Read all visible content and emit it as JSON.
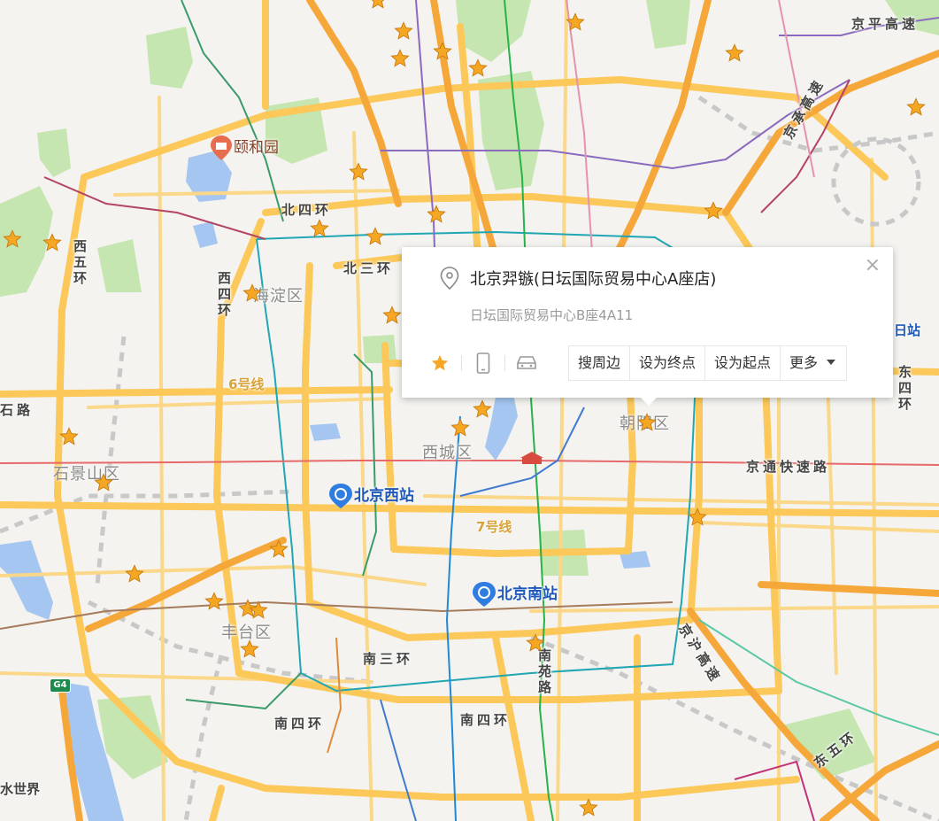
{
  "popup": {
    "title": "北京羿镞(日坛国际贸易中心A座店)",
    "address": "日坛国际贸易中心B座4A11",
    "close_label": "×",
    "actions": [
      "搜周边",
      "设为终点",
      "设为起点",
      "更多"
    ],
    "icons": [
      "star-icon",
      "phone-icon",
      "car-icon"
    ]
  },
  "districts": [
    "海淀区",
    "西城区",
    "朝阳区",
    "石景山区",
    "丰台区"
  ],
  "roads": {
    "bei_si_huan": "北四环",
    "bei_san_huan": "北三环",
    "nan_san_huan": "南三环",
    "nan_si_huan_w": "南四环",
    "nan_si_huan_e": "南四环",
    "xi_si_huan": "西四环",
    "xi_wu_huan": "西五环",
    "dong_wu_huan": "东五环",
    "jing_ping": "京平高速",
    "jing_cheng": "京承高速",
    "jing_tong": "京通快速路",
    "jing_hu": "京沪高速",
    "nan_yuan_lu": "南苑路",
    "dong_si_huan": "东四环",
    "shi_lu": "石路",
    "shuishijie": "水世界",
    "line6": "6号线",
    "line7": "7号线",
    "g4": "G4",
    "ri_zhan": "日站"
  },
  "pois": {
    "summer_palace": "颐和园",
    "beijing_west": "北京西站",
    "beijing_south": "北京南站"
  },
  "colors": {
    "background": "#f4f3ef",
    "green": "#c5e6b1",
    "water": "#a5c6f0",
    "road_major": "#fbc859",
    "road_express": "#f6a73a",
    "marker": "#f5a623",
    "station_blue": "#2f7de1"
  }
}
